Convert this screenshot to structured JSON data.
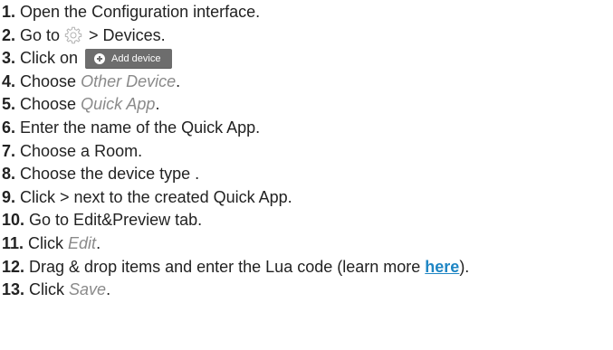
{
  "steps": [
    {
      "num": "1.",
      "text": "Open the Configuration interface."
    },
    {
      "num": "2.",
      "pre": "Go to",
      "icon": "gear-icon",
      "post": "> Devices."
    },
    {
      "num": "3.",
      "pre": "Click on",
      "button_label": "Add device",
      "button_icon": "plus-circle-icon"
    },
    {
      "num": "4.",
      "pre": "Choose ",
      "em": "Other Device",
      "post": "."
    },
    {
      "num": "5.",
      "pre": "Choose ",
      "em": "Quick App",
      "post": "."
    },
    {
      "num": "6.",
      "text": "Enter the name of the Quick App."
    },
    {
      "num": "7.",
      "text": "Choose a Room."
    },
    {
      "num": "8.",
      "text": "Choose the device type ."
    },
    {
      "num": "9.",
      "text": "Click > next to the created Quick App."
    },
    {
      "num": "10.",
      "text": "Go to Edit&Preview tab."
    },
    {
      "num": "11.",
      "pre": "Click ",
      "em": "Edit",
      "post": "."
    },
    {
      "num": "12.",
      "pre": "Drag & drop items and enter the Lua code (learn more ",
      "link": "here",
      "post": ")."
    },
    {
      "num": "13.",
      "pre": "Click ",
      "em": "Save",
      "post": "."
    }
  ],
  "colors": {
    "text": "#222222",
    "muted_italic": "#8a8a8a",
    "link": "#1f86c4",
    "button_bg": "#6d6d6d"
  }
}
